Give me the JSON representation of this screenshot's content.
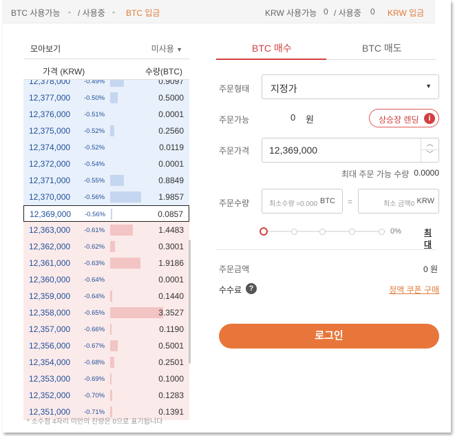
{
  "topbar": {
    "btc_available_label": "BTC 사용가능",
    "btc_available_value": "-",
    "btc_in_use_label": "/ 사용중",
    "btc_in_use_value": "-",
    "btc_deposit": "BTC 입금",
    "krw_available_label": "KRW 사용가능",
    "krw_available_value": "0",
    "krw_in_use_label": "/ 사용중",
    "krw_in_use_value": "0",
    "krw_deposit": "KRW 입금"
  },
  "orderbook": {
    "view_all": "모아보기",
    "unused": "미사용",
    "col_price": "가격 (KRW)",
    "col_qty": "수량(BTC)",
    "asks": [
      {
        "price": "12,378,000",
        "pct": "-0.49%",
        "qty": "0.9097",
        "depth": 0.18
      },
      {
        "price": "12,377,000",
        "pct": "-0.50%",
        "qty": "0.5000",
        "depth": 0.1
      },
      {
        "price": "12,376,000",
        "pct": "-0.51%",
        "qty": "0.0001",
        "depth": 0.0
      },
      {
        "price": "12,375,000",
        "pct": "-0.52%",
        "qty": "0.2560",
        "depth": 0.05
      },
      {
        "price": "12,374,000",
        "pct": "-0.52%",
        "qty": "0.0119",
        "depth": 0.0
      },
      {
        "price": "12,372,000",
        "pct": "-0.54%",
        "qty": "0.0001",
        "depth": 0.0
      },
      {
        "price": "12,371,000",
        "pct": "-0.55%",
        "qty": "0.8849",
        "depth": 0.18
      },
      {
        "price": "12,370,000",
        "pct": "-0.56%",
        "qty": "1.9857",
        "depth": 0.41
      }
    ],
    "current": {
      "price": "12,369,000",
      "pct": "-0.56%",
      "qty": "0.0857",
      "depth": 0.02
    },
    "bids": [
      {
        "price": "12,363,000",
        "pct": "-0.61%",
        "qty": "1.4483",
        "depth": 0.3
      },
      {
        "price": "12,362,000",
        "pct": "-0.62%",
        "qty": "0.3001",
        "depth": 0.06
      },
      {
        "price": "12,361,000",
        "pct": "-0.63%",
        "qty": "1.9186",
        "depth": 0.4
      },
      {
        "price": "12,360,000",
        "pct": "-0.64%",
        "qty": "0.0001",
        "depth": 0.0
      },
      {
        "price": "12,359,000",
        "pct": "-0.64%",
        "qty": "0.1440",
        "depth": 0.03
      },
      {
        "price": "12,358,000",
        "pct": "-0.65%",
        "qty": "3.3527",
        "depth": 0.7
      },
      {
        "price": "12,357,000",
        "pct": "-0.66%",
        "qty": "0.1190",
        "depth": 0.02
      },
      {
        "price": "12,356,000",
        "pct": "-0.67%",
        "qty": "0.5001",
        "depth": 0.1
      },
      {
        "price": "12,354,000",
        "pct": "-0.68%",
        "qty": "0.2501",
        "depth": 0.05
      },
      {
        "price": "12,353,000",
        "pct": "-0.69%",
        "qty": "0.1000",
        "depth": 0.02
      },
      {
        "price": "12,352,000",
        "pct": "-0.70%",
        "qty": "0.1283",
        "depth": 0.03
      },
      {
        "price": "12,351,000",
        "pct": "-0.71%",
        "qty": "0.1391",
        "depth": 0.03
      }
    ],
    "note": "* 소수점 4자리 미만의 잔량은 0으로 표기됩니다"
  },
  "order": {
    "tab_buy": "BTC 매수",
    "tab_sell": "BTC 매도",
    "order_type_label": "주문형태",
    "order_type_value": "지정가",
    "available_label": "주문가능",
    "available_value": "0",
    "available_unit": "원",
    "rental_button": "상승장 렌딩",
    "price_label": "주문가격",
    "price_value": "12,369,000",
    "max_label": "최대 주문 가능 수량",
    "max_value": "0.0000",
    "qty_label": "주문수량",
    "qty_placeholder": "최소수량 ≈0.000",
    "qty_unit": "BTC",
    "equals": "=",
    "amount_placeholder": "최소 금액0",
    "amount_unit": "KRW",
    "slider_percent": "0%",
    "slider_value": 0,
    "max_button": "최대",
    "total_label": "주문금액",
    "total_value": "0 원",
    "fee_label": "수수료",
    "coupon_link": "정액 쿠폰 구매",
    "login_button": "로그인"
  },
  "colors": {
    "accent_red": "#d33f3f",
    "accent_orange": "#e8763a",
    "ask_bg": "#e8f0fb",
    "bid_bg": "#fbeaea",
    "price_blue": "#1f4f9b"
  }
}
